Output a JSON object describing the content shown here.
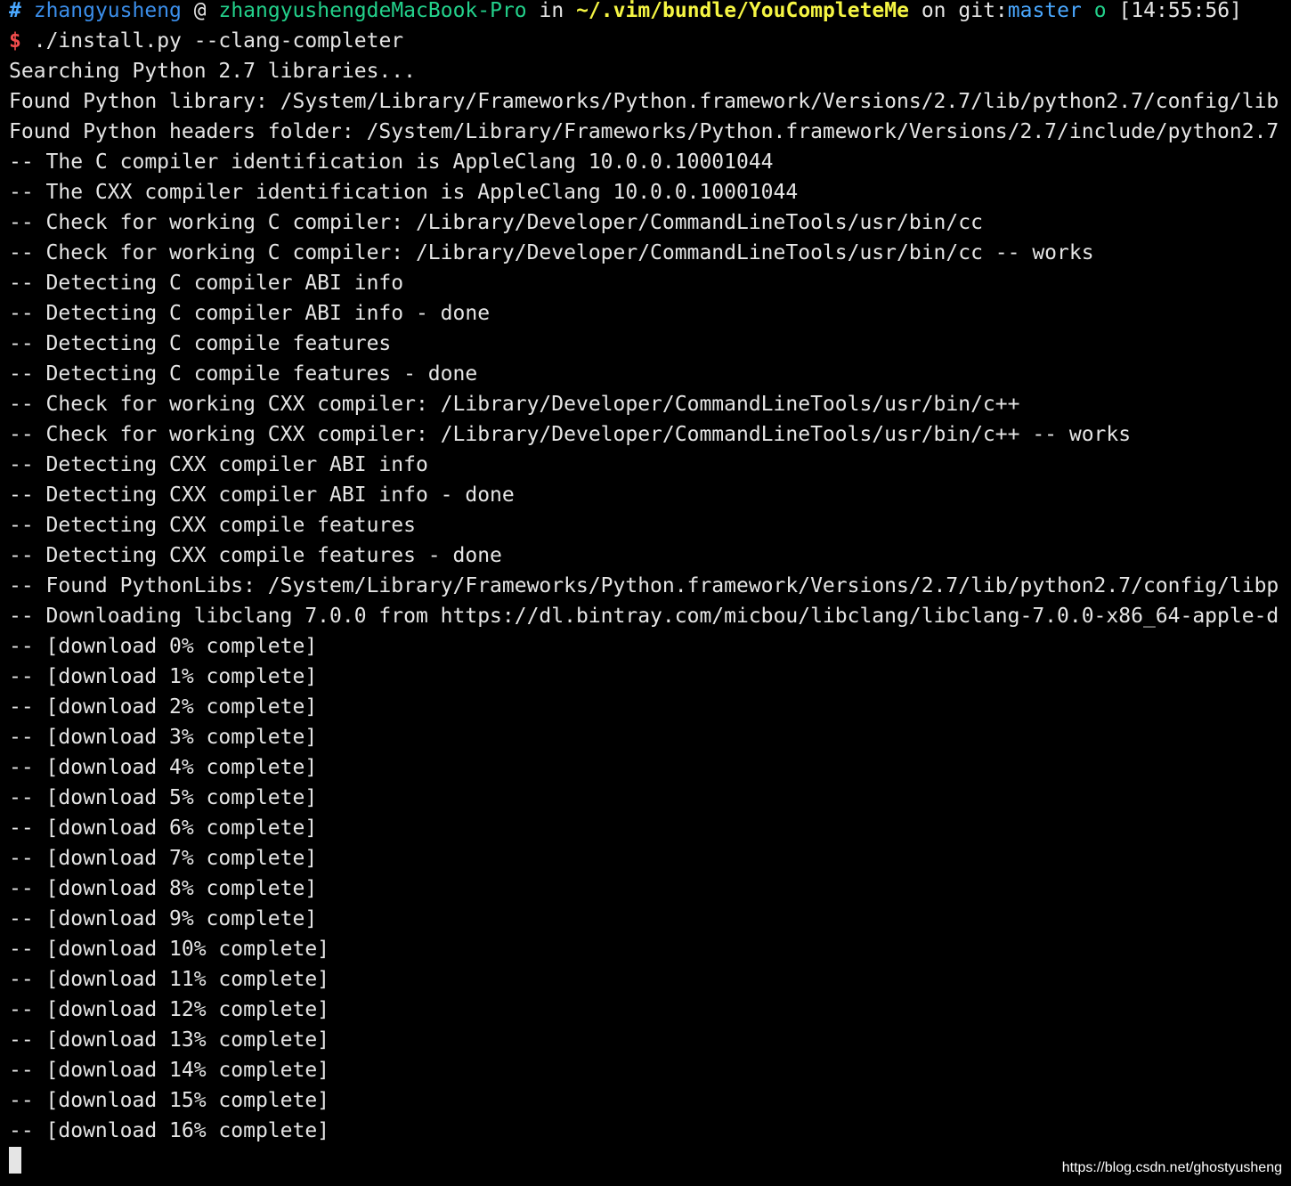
{
  "colors": {
    "background": "#000000",
    "text": "#e5e5e5",
    "hash": "#4aa8ff",
    "user": "#3b8eea",
    "host": "#23d18b",
    "path": "#f5f543",
    "branch": "#4aa8ff",
    "dollar": "#f14c4c"
  },
  "prompt": {
    "hash": "#",
    "user": "zhangyusheng",
    "at": "@",
    "host": "zhangyushengdeMacBook-Pro",
    "in": "in",
    "path": "~/.vim/bundle/YouCompleteMe",
    "on": "on",
    "git_label": "git:",
    "branch": "master",
    "status": "o",
    "time": "[14:55:56]"
  },
  "command": {
    "dollar": "$",
    "text": "./install.py --clang-completer"
  },
  "output_lines": [
    "Searching Python 2.7 libraries...",
    "Found Python library: /System/Library/Frameworks/Python.framework/Versions/2.7/lib/python2.7/config/lib",
    "Found Python headers folder: /System/Library/Frameworks/Python.framework/Versions/2.7/include/python2.7",
    "-- The C compiler identification is AppleClang 10.0.0.10001044",
    "-- The CXX compiler identification is AppleClang 10.0.0.10001044",
    "-- Check for working C compiler: /Library/Developer/CommandLineTools/usr/bin/cc",
    "-- Check for working C compiler: /Library/Developer/CommandLineTools/usr/bin/cc -- works",
    "-- Detecting C compiler ABI info",
    "-- Detecting C compiler ABI info - done",
    "-- Detecting C compile features",
    "-- Detecting C compile features - done",
    "-- Check for working CXX compiler: /Library/Developer/CommandLineTools/usr/bin/c++",
    "-- Check for working CXX compiler: /Library/Developer/CommandLineTools/usr/bin/c++ -- works",
    "-- Detecting CXX compiler ABI info",
    "-- Detecting CXX compiler ABI info - done",
    "-- Detecting CXX compile features",
    "-- Detecting CXX compile features - done",
    "-- Found PythonLibs: /System/Library/Frameworks/Python.framework/Versions/2.7/lib/python2.7/config/libp",
    "-- Downloading libclang 7.0.0 from https://dl.bintray.com/micbou/libclang/libclang-7.0.0-x86_64-apple-d",
    "-- [download 0% complete]",
    "-- [download 1% complete]",
    "-- [download 2% complete]",
    "-- [download 3% complete]",
    "-- [download 4% complete]",
    "-- [download 5% complete]",
    "-- [download 6% complete]",
    "-- [download 7% complete]",
    "-- [download 8% complete]",
    "-- [download 9% complete]",
    "-- [download 10% complete]",
    "-- [download 11% complete]",
    "-- [download 12% complete]",
    "-- [download 13% complete]",
    "-- [download 14% complete]",
    "-- [download 15% complete]",
    "-- [download 16% complete]"
  ],
  "watermark": "https://blog.csdn.net/ghostyusheng"
}
